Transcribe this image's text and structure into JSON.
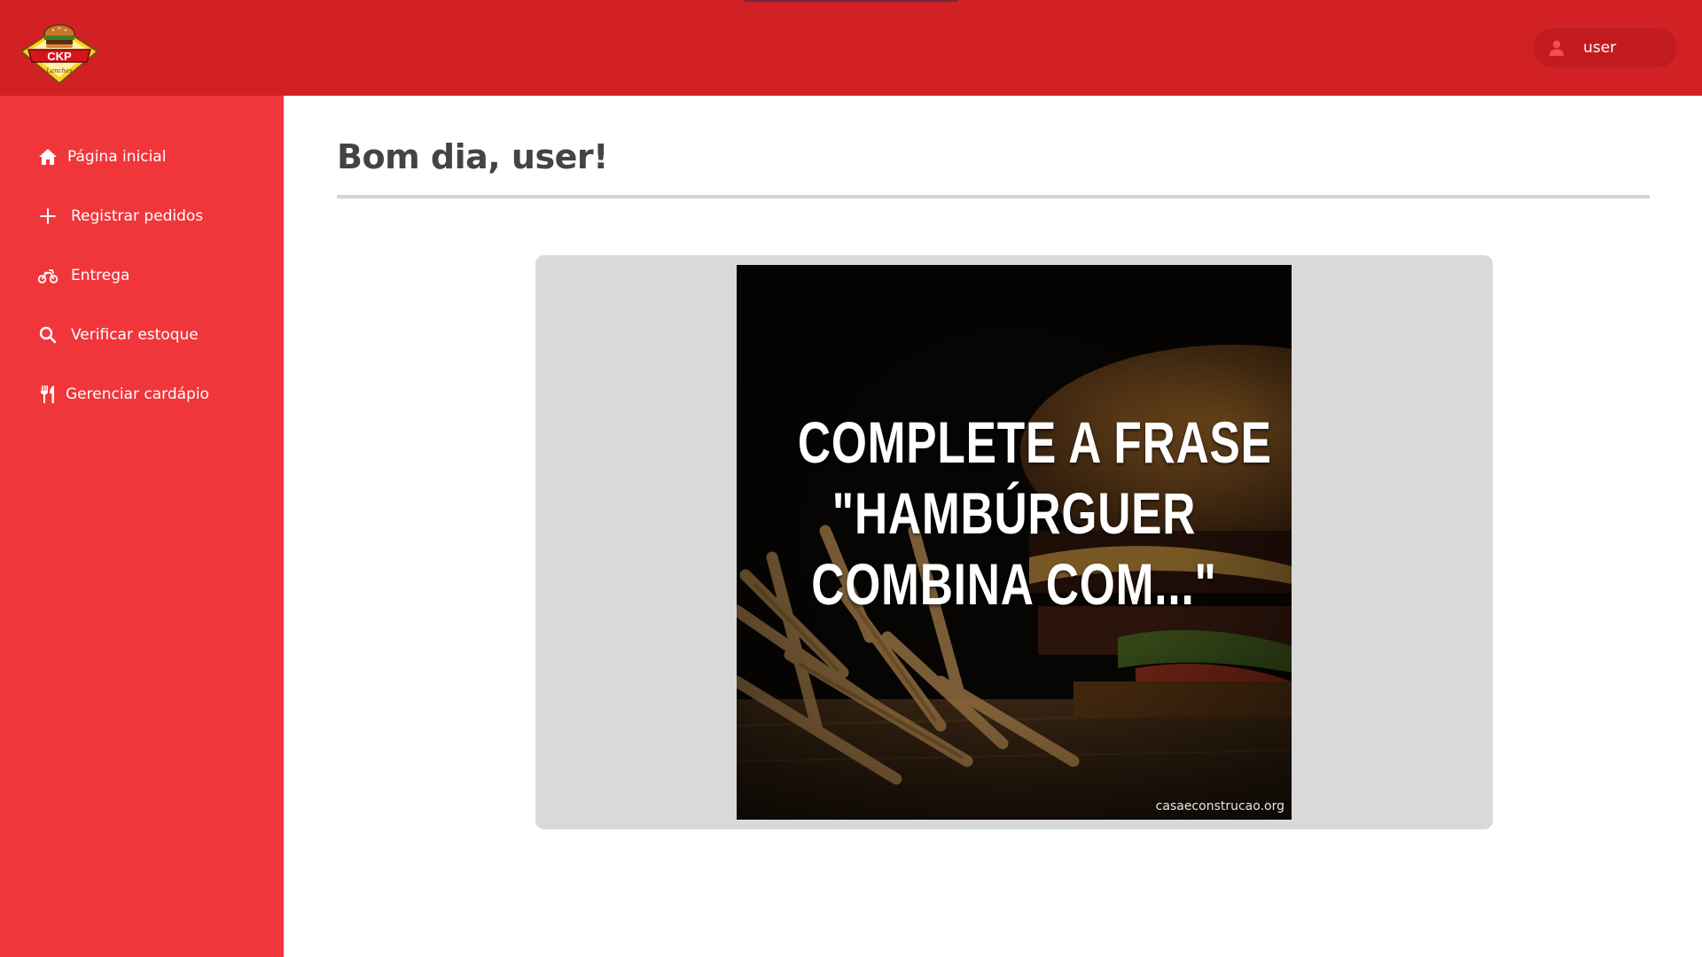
{
  "header": {
    "logo": {
      "text": "CKP",
      "subtext": "Lanches"
    },
    "user": {
      "icon": "user-icon",
      "name": "user"
    }
  },
  "sidebar": {
    "items": [
      {
        "icon": "home-icon",
        "label": "Página inicial"
      },
      {
        "icon": "plus-icon",
        "label": "Registrar pedidos"
      },
      {
        "icon": "motorcycle-icon",
        "label": "Entrega"
      },
      {
        "icon": "search-icon",
        "label": "Verificar estoque"
      },
      {
        "icon": "utensils-icon",
        "label": "Gerenciar cardápio"
      }
    ]
  },
  "main": {
    "greeting": "Bom dia, user!",
    "promo": {
      "lines": [
        "COMPLETE A FRASE",
        "\"HAMBÚRGUER",
        "COMBINA COM...\""
      ],
      "credit": "casaeconstrucao.org"
    }
  },
  "colors": {
    "topbar": "#d12125",
    "sidebar": "#f1363b",
    "title_text": "#444444",
    "card_background": "#d9d9d9"
  }
}
